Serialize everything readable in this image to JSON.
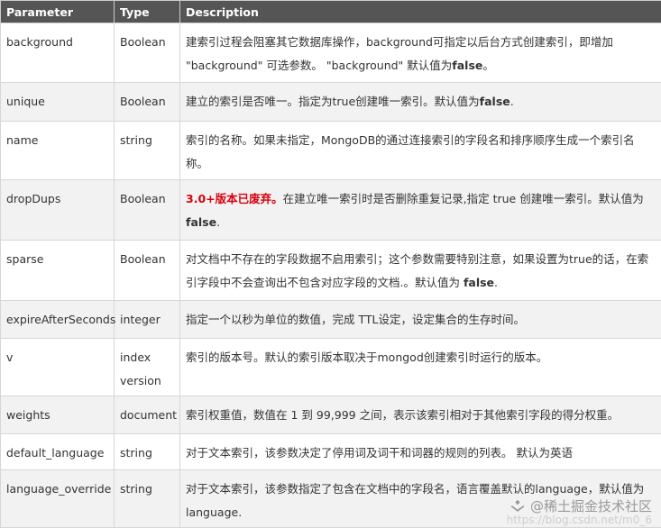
{
  "header": {
    "col_param": "Parameter",
    "col_type": "Type",
    "col_desc": "Description"
  },
  "rows": [
    {
      "param": "background",
      "type": "Boolean",
      "desc": [
        {
          "t": "建索引过程会阻塞其它数据库操作，background可指定以后台方式创建索引，即增加 \"background\" 可选参数。 \"background\" 默认值为"
        },
        {
          "t": "false",
          "b": true
        },
        {
          "t": "。"
        }
      ]
    },
    {
      "param": "unique",
      "type": "Boolean",
      "desc": [
        {
          "t": "建立的索引是否唯一。指定为true创建唯一索引。默认值为"
        },
        {
          "t": "false",
          "b": true
        },
        {
          "t": "."
        }
      ]
    },
    {
      "param": "name",
      "type": "string",
      "desc": [
        {
          "t": "索引的名称。如果未指定，MongoDB的通过连接索引的字段名和排序顺序生成一个索引名称。"
        }
      ]
    },
    {
      "param": "dropDups",
      "type": "Boolean",
      "desc": [
        {
          "t": "3.0+版本已废弃。",
          "warn": true
        },
        {
          "t": "在建立唯一索引时是否删除重复记录,指定 true 创建唯一索引。默认值为 "
        },
        {
          "t": "false",
          "b": true
        },
        {
          "t": "."
        }
      ]
    },
    {
      "param": "sparse",
      "type": "Boolean",
      "desc": [
        {
          "t": "对文档中不存在的字段数据不启用索引；这个参数需要特别注意，如果设置为true的话，在索引字段中不会查询出不包含对应字段的文档.。默认值为 "
        },
        {
          "t": "false",
          "b": true
        },
        {
          "t": "."
        }
      ]
    },
    {
      "param": "expireAfterSeconds",
      "type": "integer",
      "desc": [
        {
          "t": "指定一个以秒为单位的数值，完成 TTL设定，设定集合的生存时间。"
        }
      ]
    },
    {
      "param": "v",
      "type": "index version",
      "desc": [
        {
          "t": "索引的版本号。默认的索引版本取决于mongod创建索引时运行的版本。"
        }
      ]
    },
    {
      "param": "weights",
      "type": "document",
      "desc": [
        {
          "t": "索引权重值，数值在 1 到 99,999 之间，表示该索引相对于其他索引字段的得分权重。"
        }
      ]
    },
    {
      "param": "default_language",
      "type": "string",
      "desc": [
        {
          "t": "对于文本索引，该参数决定了停用词及词干和词器的规则的列表。 默认为英语"
        }
      ]
    },
    {
      "param": "language_override",
      "type": "string",
      "desc": [
        {
          "t": "对于文本索引，该参数指定了包含在文档中的字段名，语言覆盖默认的language，默认值为 language."
        }
      ]
    }
  ],
  "watermark": {
    "text": "@稀土掘金技术社区",
    "url": "https://blog.csdn.net/m0_6"
  }
}
